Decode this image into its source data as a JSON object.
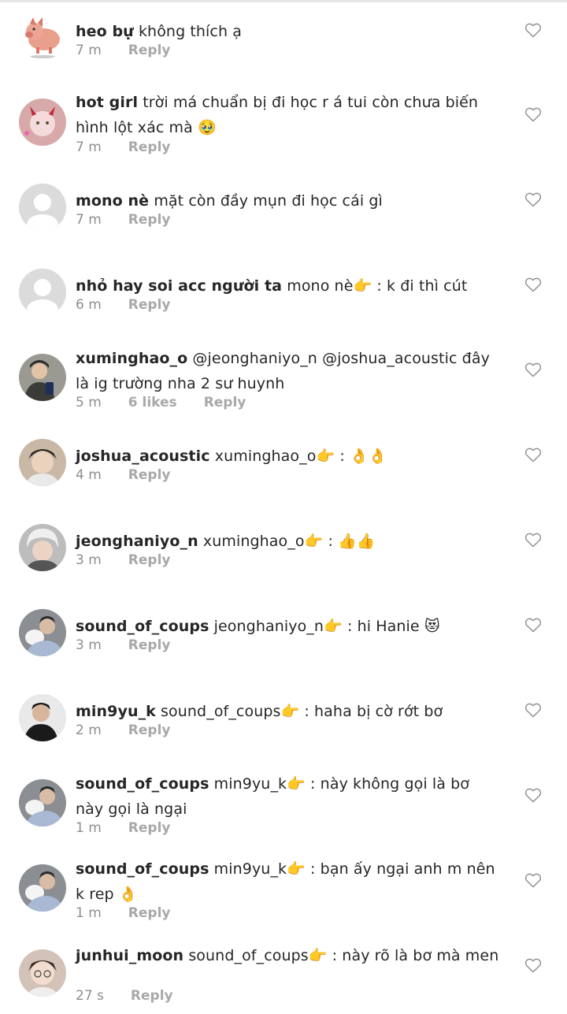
{
  "comments": [
    {
      "user": "heo bự",
      "text": "không thích ạ",
      "time": "7 m",
      "likes": "",
      "reply": "Reply",
      "avatar": "pig"
    },
    {
      "user": "hot girl",
      "text": "trời má chuẩn bị đi học r á tui còn chưa biến hình lột xác mà",
      "emoji": "🥹",
      "time": "7 m",
      "likes": "",
      "reply": "Reply",
      "avatar": "girl-filter"
    },
    {
      "user": "mono nè",
      "text": "mặt còn đầy mụn đi học cái gì",
      "time": "7 m",
      "likes": "",
      "reply": "Reply",
      "avatar": "default"
    },
    {
      "user": "nhỏ hay soi acc người ta",
      "text": "mono nè👉 : k đi thì cút",
      "time": "6 m",
      "likes": "",
      "reply": "Reply",
      "avatar": "default"
    },
    {
      "user": "xuminghao_o",
      "text": "@jeonghaniyo_n @joshua_acoustic đây là ig trường nha 2 sư huynh",
      "time": "5 m",
      "likes": "6 likes",
      "reply": "Reply",
      "avatar": "photo-a"
    },
    {
      "user": "joshua_acoustic",
      "text": "xuminghao_o👉 : 👌👌",
      "time": "4 m",
      "likes": "",
      "reply": "Reply",
      "avatar": "photo-b"
    },
    {
      "user": "jeonghaniyo_n",
      "text": "xuminghao_o👉 : 👍👍",
      "time": "3 m",
      "likes": "",
      "reply": "Reply",
      "avatar": "photo-c"
    },
    {
      "user": "sound_of_coups",
      "text": "jeonghaniyo_n👉 : hi Hanie 😻",
      "time": "3 m",
      "likes": "",
      "reply": "Reply",
      "avatar": "photo-d"
    },
    {
      "user": "min9yu_k",
      "text": "sound_of_coups👉 : haha bị cờ rớt bơ",
      "time": "2 m",
      "likes": "",
      "reply": "Reply",
      "avatar": "photo-e"
    },
    {
      "user": "sound_of_coups",
      "text": "min9yu_k👉 : này không gọi là bơ này gọi là ngại",
      "time": "1 m",
      "likes": "",
      "reply": "Reply",
      "avatar": "photo-d"
    },
    {
      "user": "sound_of_coups",
      "text": "min9yu_k👉 : bạn ấy ngại anh m nên k rep 👌",
      "time": "1 m",
      "likes": "",
      "reply": "Reply",
      "avatar": "photo-d"
    },
    {
      "user": "junhui_moon",
      "text": "sound_of_coups👉 : này rõ là bơ mà men",
      "time": "27 s",
      "likes": "",
      "reply": "Reply",
      "avatar": "photo-f"
    }
  ],
  "colors": {
    "text": "#262626",
    "meta": "#8e8e8e",
    "reply": "#a8a8a8",
    "heart": "#8e8e8e"
  }
}
